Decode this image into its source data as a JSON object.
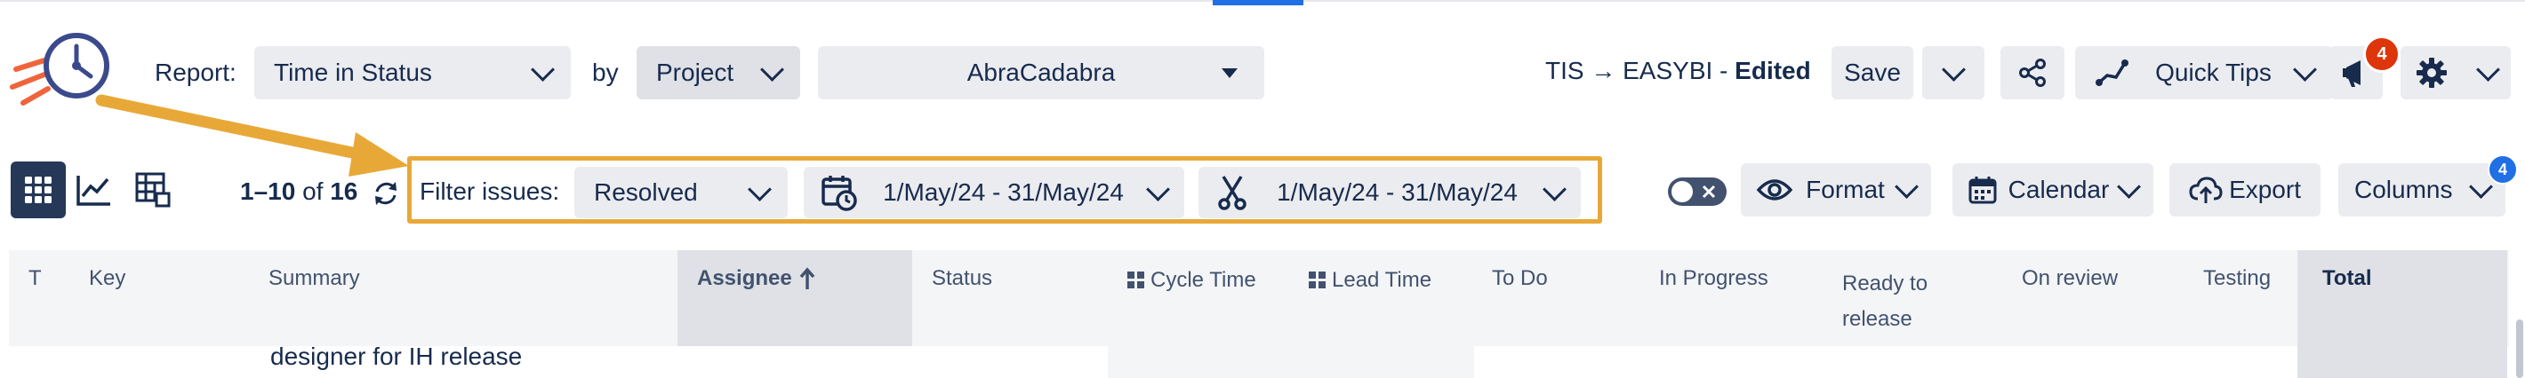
{
  "header": {
    "report_label": "Report:",
    "report_value": "Time in Status",
    "by_label": "by",
    "by_value": "Project",
    "project_value": "AbraCadabra",
    "title": "TIS → EASYBI - ",
    "title_status": "Edited",
    "save_label": "Save",
    "quick_tips_label": "Quick Tips",
    "notifications_count": "4"
  },
  "toolbar": {
    "range_prefix": "1–10",
    "range_of": " of ",
    "range_total": "16",
    "filter_label": "Filter issues:",
    "filter_value": "Resolved",
    "date_range_1": "1/May/24 - 31/May/24",
    "date_range_2": "1/May/24 - 31/May/24",
    "format_label": "Format",
    "calendar_label": "Calendar",
    "export_label": "Export",
    "columns_label": "Columns",
    "columns_badge": "4"
  },
  "table": {
    "headers": {
      "t": "T",
      "key": "Key",
      "summary": "Summary",
      "assignee": "Assignee",
      "status": "Status",
      "cycle_time": "Cycle Time",
      "lead_time": "Lead Time",
      "to_do": "To Do",
      "in_progress": "In Progress",
      "ready_line1": "Ready to",
      "ready_line2": "release",
      "on_review": "On review",
      "testing": "Testing",
      "total": "Total"
    },
    "rows": [
      {
        "summary": "designer for IH release"
      }
    ]
  },
  "colors": {
    "accent": "#1f6fe5",
    "highlight": "#e8a838",
    "badge": "#de350b",
    "active_view": "#253858"
  }
}
